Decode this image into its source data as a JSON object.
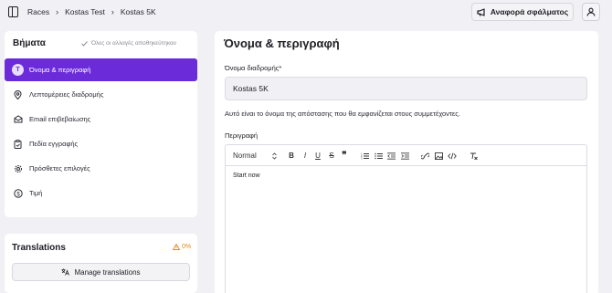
{
  "breadcrumb": {
    "items": [
      "Races",
      "Kostas Test",
      "Kostas 5K"
    ],
    "separator": "›"
  },
  "header": {
    "report_button": "Αναφορά σφάλματος"
  },
  "steps": {
    "title": "Βήματα",
    "saved_note": "Όλες οι αλλαγές αποθηκεύτηκαν",
    "items": [
      {
        "label": "Όνομα & περιγραφή",
        "icon": "text-icon",
        "active": true
      },
      {
        "label": "Λεπτομέρειες διαδρομής",
        "icon": "location-pin-icon"
      },
      {
        "label": "Email επιβεβαίωσης",
        "icon": "envelope-icon"
      },
      {
        "label": "Πεδία εγγραφής",
        "icon": "clipboard-icon"
      },
      {
        "label": "Πρόσθετες επιλογές",
        "icon": "gear-icon"
      },
      {
        "label": "Τιμή",
        "icon": "dollar-icon"
      }
    ],
    "active_icon_glyph": "T"
  },
  "translations": {
    "title": "Translations",
    "percent": "0%",
    "manage_button": "Manage translations"
  },
  "main": {
    "title": "Όνομα & περιγραφή",
    "name_label": "Όνομα διαδρομής*",
    "name_value": "Kostas 5K",
    "name_help": "Αυτό είναι το όνομα της απόστασης που θα εμφανίζεται στους συμμετέχοντες.",
    "description_label": "Περιγραφή",
    "editor": {
      "format_select": "Normal",
      "content": "Start now",
      "tools": [
        "bold",
        "italic",
        "underline",
        "strike",
        "blockquote",
        "ordered-list",
        "bullet-list",
        "outdent",
        "indent",
        "link",
        "image",
        "code",
        "clear-format"
      ]
    }
  },
  "colors": {
    "accent": "#6c2bd9",
    "warning": "#e08a1e",
    "background": "#f1f0f4"
  }
}
